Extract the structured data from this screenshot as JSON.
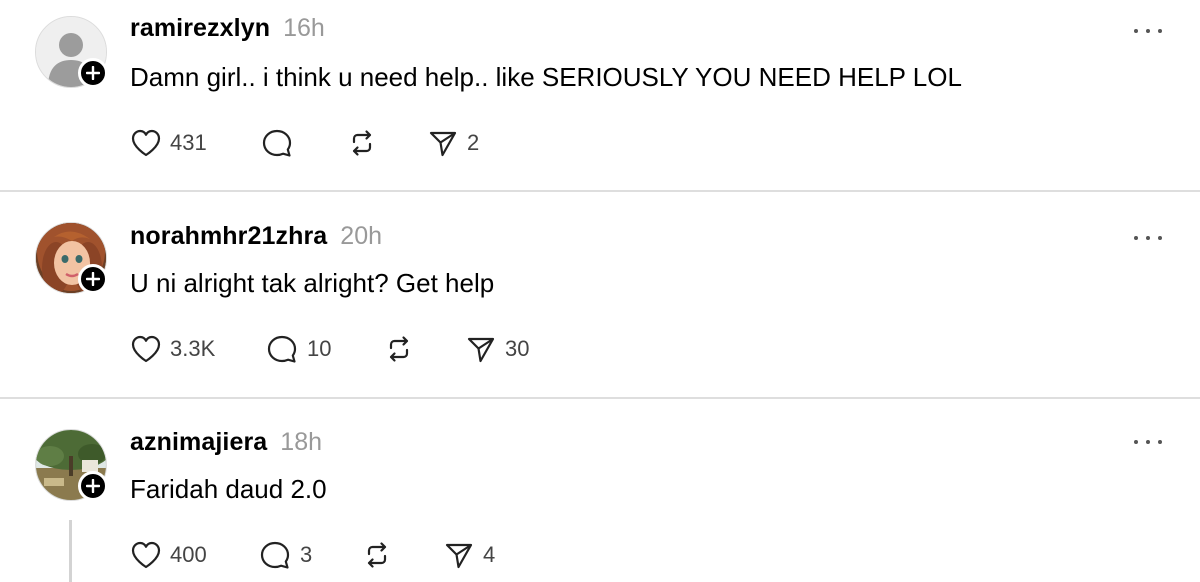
{
  "posts": [
    {
      "username": "ramirezxlyn",
      "time": "16h",
      "text": "Damn girl.. i think u need help.. like SERIOUSLY YOU NEED HELP LOL",
      "avatar": "default-user-icon",
      "likes": "431",
      "replies": "",
      "reposts": "",
      "shares": "2"
    },
    {
      "username": "norahmhr21zhra",
      "time": "20h",
      "text": "U ni alright tak alright? Get help",
      "avatar": "doll-face-photo",
      "likes": "3.3K",
      "replies": "10",
      "reposts": "",
      "shares": "30"
    },
    {
      "username": "aznimajiera",
      "time": "18h",
      "text": "Faridah daud 2.0",
      "avatar": "tree-landscape-photo",
      "likes": "400",
      "replies": "3",
      "reposts": "",
      "shares": "4"
    }
  ],
  "icons": {
    "like": "heart-icon",
    "reply": "comment-bubble-icon",
    "repost": "repost-arrows-icon",
    "share": "send-icon",
    "more": "more-horizontal-icon",
    "follow": "plus-icon"
  },
  "colors": {
    "text": "#000000",
    "muted": "#999999",
    "count": "#444444",
    "divider": "#dedede",
    "badge": "#000000"
  }
}
